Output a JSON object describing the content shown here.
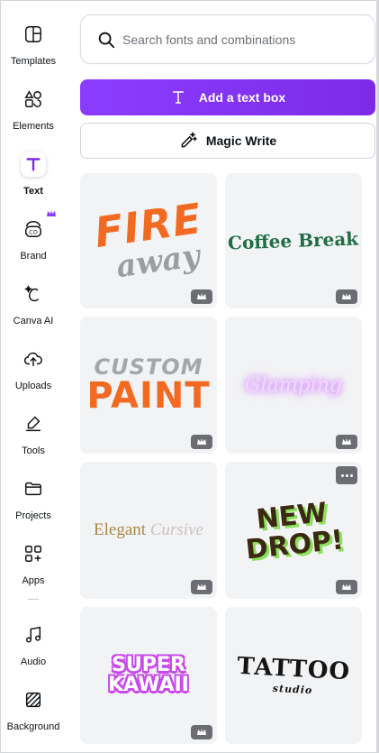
{
  "sidebar": {
    "items": [
      {
        "label": "Templates",
        "icon": "templates-icon"
      },
      {
        "label": "Elements",
        "icon": "elements-icon"
      },
      {
        "label": "Text",
        "icon": "text-icon",
        "active": true
      },
      {
        "label": "Brand",
        "icon": "brand-icon",
        "premium": true
      },
      {
        "label": "Canva AI",
        "icon": "canva-ai-icon"
      },
      {
        "label": "Uploads",
        "icon": "uploads-icon"
      },
      {
        "label": "Tools",
        "icon": "tools-icon"
      },
      {
        "label": "Projects",
        "icon": "projects-icon"
      },
      {
        "label": "Apps",
        "icon": "apps-icon"
      },
      {
        "label": "Audio",
        "icon": "audio-icon"
      },
      {
        "label": "Background",
        "icon": "background-icon"
      }
    ]
  },
  "search": {
    "placeholder": "Search fonts and combinations"
  },
  "buttons": {
    "add_text_box": "Add a text box",
    "magic_write": "Magic Write"
  },
  "font_combos": [
    {
      "name": "fire-away",
      "line1": "FIRE",
      "line2": "away",
      "premium": true
    },
    {
      "name": "coffee-break",
      "line1": "Coffee Break",
      "premium": true
    },
    {
      "name": "custom-paint",
      "line1": "CUSTOM",
      "line2": "PAINT",
      "premium": true
    },
    {
      "name": "glamping",
      "line1": "Glamping",
      "premium": true
    },
    {
      "name": "elegant-cursive",
      "line1": "Elegant",
      "line2": "Cursive",
      "premium": true
    },
    {
      "name": "new-drop",
      "line1": "NEW",
      "line2": "DROP!",
      "premium": true
    },
    {
      "name": "super-kawaii",
      "line1": "SUPER",
      "line2": "KAWAII",
      "premium": true
    },
    {
      "name": "tattoo-studio",
      "line1": "TATTOO",
      "line2": "studio",
      "premium": true
    }
  ],
  "colors": {
    "accent_purple": "#8b3dff",
    "premium_badge": "#6b6d72",
    "card_bg": "#f2f3f5"
  }
}
